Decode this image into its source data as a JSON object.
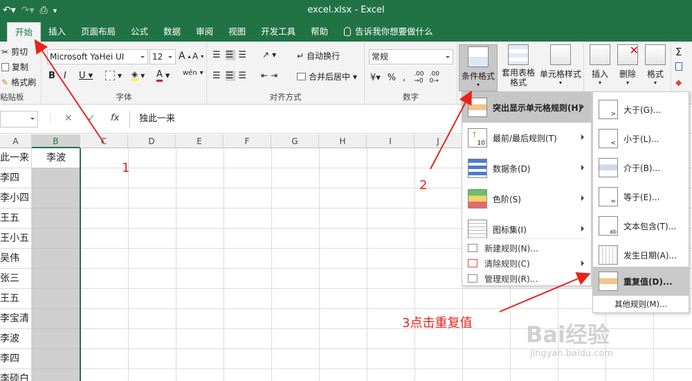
{
  "window": {
    "title": "excel.xlsx - Excel"
  },
  "tabs": [
    "开始",
    "插入",
    "页面布局",
    "公式",
    "数据",
    "审阅",
    "视图",
    "开发工具",
    "帮助"
  ],
  "tellme": "告诉我你想要做什么",
  "ribbon": {
    "clipboard": {
      "cut": "剪切",
      "copy": "复制",
      "format_painter": "格式刷",
      "label": "粘贴板"
    },
    "font": {
      "family": "Microsoft YaHei UI",
      "size": "12",
      "label": "字体"
    },
    "alignment": {
      "wrap": "自动换行",
      "merge": "合并后居中",
      "label": "对齐方式"
    },
    "number": {
      "format": "常规",
      "label": "数字"
    },
    "styles": {
      "conditional": "条件格式",
      "table": "套用表格格式",
      "cell_styles": "单元格样式"
    },
    "cells": {
      "insert": "插入",
      "delete": "删除",
      "format": "格式"
    }
  },
  "formula_bar": {
    "value": "独此一来",
    "fx": "fx"
  },
  "columns": [
    "A",
    "B",
    "C",
    "D",
    "E",
    "F",
    "G",
    "H",
    "I",
    "J"
  ],
  "cells": {
    "b1": "李波",
    "a": [
      "此一来",
      "李四",
      "李小四",
      "王五",
      "王小五",
      "吴伟",
      "张三",
      "王五",
      "李宝清",
      "李波",
      "李四",
      "李硕白"
    ]
  },
  "menu_cf": {
    "items": [
      "突出显示单元格规则(H)",
      "最前/最后规则(T)",
      "数据条(D)",
      "色阶(S)",
      "图标集(I)"
    ],
    "small": [
      "新建规则(N)...",
      "清除规则(C)",
      "管理规则(R)..."
    ]
  },
  "menu_highlight": {
    "items": [
      "大于(G)...",
      "小于(L)...",
      "介于(B)...",
      "等于(E)...",
      "文本包含(T)...",
      "发生日期(A)...",
      "重复值(D)..."
    ],
    "more": "其他规则(M)..."
  },
  "annotations": {
    "a1": "1",
    "a2": "2",
    "a3": "3点击重复值"
  },
  "watermark": {
    "text": "Bai经验",
    "url": "jingyan.baidu.com"
  }
}
